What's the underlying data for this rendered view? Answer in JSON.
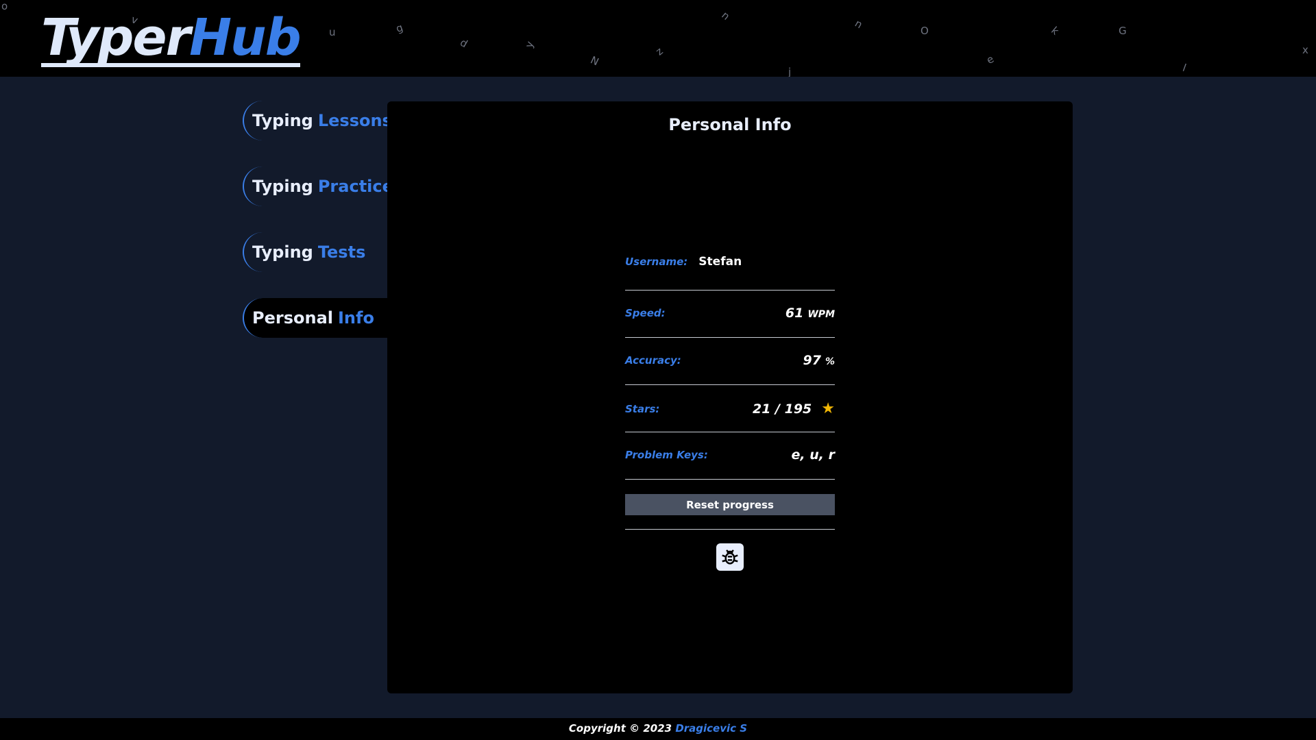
{
  "header": {
    "logo_part1": "Typer",
    "logo_part2": "Hub",
    "background_letters": [
      "u",
      "g",
      "d",
      "y",
      "N",
      "z",
      "n",
      "n",
      "O",
      "e",
      "k",
      "G",
      "x",
      "v",
      "o",
      "j",
      "l"
    ]
  },
  "sidebar": {
    "items": [
      {
        "word1": "Typing",
        "word2": "Lessons",
        "active": false
      },
      {
        "word1": "Typing",
        "word2": "Practice",
        "active": false
      },
      {
        "word1": "Typing",
        "word2": "Tests",
        "active": false
      },
      {
        "word1": "Personal",
        "word2": "Info",
        "active": true
      }
    ]
  },
  "main": {
    "title": "Personal Info",
    "username_label": "Username:",
    "username_value": "Stefan",
    "speed_label": "Speed:",
    "speed_value": "61",
    "speed_unit": "WPM",
    "accuracy_label": "Accuracy:",
    "accuracy_value": "97",
    "accuracy_unit": "%",
    "stars_label": "Stars:",
    "stars_value": "21 / 195",
    "stars_icon": "star-icon",
    "problem_keys_label": "Problem Keys:",
    "problem_keys_value": "e, u, r",
    "reset_button_label": "Reset progress",
    "bug_icon": "bug-icon"
  },
  "footer": {
    "copyright": "Copyright © 2023",
    "author": "Dragicevic S"
  },
  "colors": {
    "accent": "#3a7ee8",
    "background": "#121a2b",
    "panel": "#000000",
    "star": "#f2b705"
  }
}
